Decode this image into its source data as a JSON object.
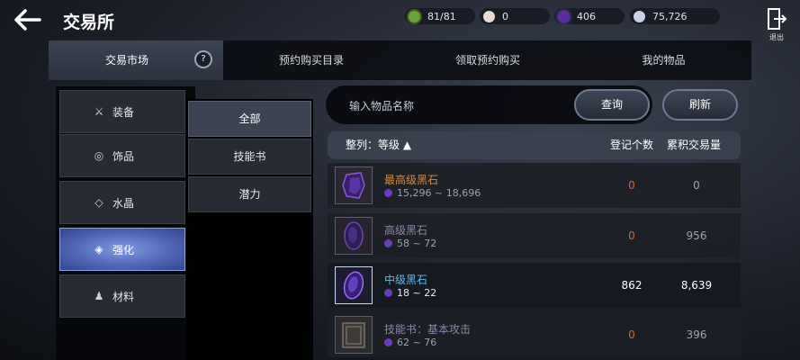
{
  "header": {
    "title": "交易所",
    "resources": [
      {
        "value": "81/81",
        "color": "#6aa33c",
        "icon": "energy-icon"
      },
      {
        "value": "0",
        "color": "#e8dcd2",
        "icon": "pearl-icon"
      },
      {
        "value": "406",
        "color": "#5a2ea0",
        "icon": "black-stone-icon"
      },
      {
        "value": "75,726",
        "color": "#c8d4e6",
        "icon": "silver-icon"
      }
    ],
    "exit_label": "退出"
  },
  "tabs": [
    {
      "label": "交易市场",
      "active": true
    },
    {
      "label": "预约购买目录",
      "active": false
    },
    {
      "label": "领取预约购买",
      "active": false
    },
    {
      "label": "我的物品",
      "active": false
    }
  ],
  "categories": [
    {
      "label": "装备",
      "icon": "crossed-swords-icon",
      "glyph": "⚔"
    },
    {
      "label": "饰品",
      "icon": "ring-icon",
      "glyph": "◎"
    },
    {
      "label": "水晶",
      "icon": "diamond-icon",
      "glyph": "◇"
    },
    {
      "label": "强化",
      "icon": "enhance-icon",
      "glyph": "◈",
      "active": true
    },
    {
      "label": "材料",
      "icon": "potion-icon",
      "glyph": "♟"
    }
  ],
  "subcategories": [
    {
      "label": "全部",
      "active": true
    },
    {
      "label": "技能书",
      "active": false
    },
    {
      "label": "潜力",
      "active": false
    }
  ],
  "search": {
    "placeholder": "输入物品名称",
    "query_label": "查询",
    "refresh_label": "刷新"
  },
  "table": {
    "sort_label": "整列：等级 ▲",
    "col_registered": "登记个数",
    "col_volume": "累积交易量",
    "rows": [
      {
        "name": "最高级黑石",
        "range": "15,296 ~ 18,696",
        "registered": "0",
        "volume": "0",
        "name_color": "#d68a3a",
        "icon": "black-stone-icon"
      },
      {
        "name": "高级黑石",
        "range": "58 ~ 72",
        "registered": "0",
        "volume": "956",
        "name_color": "#8c86a8",
        "icon": "black-stone-icon"
      },
      {
        "name": "中级黑石",
        "range": "18 ~ 22",
        "registered": "862",
        "volume": "8,639",
        "name_color": "#63b8f0",
        "icon": "black-stone-icon",
        "selected": true
      },
      {
        "name": "技能书：基本攻击",
        "range": "62 ~ 76",
        "registered": "0",
        "volume": "396",
        "name_color": "#8c86a8",
        "icon": "skill-book-icon"
      }
    ]
  }
}
